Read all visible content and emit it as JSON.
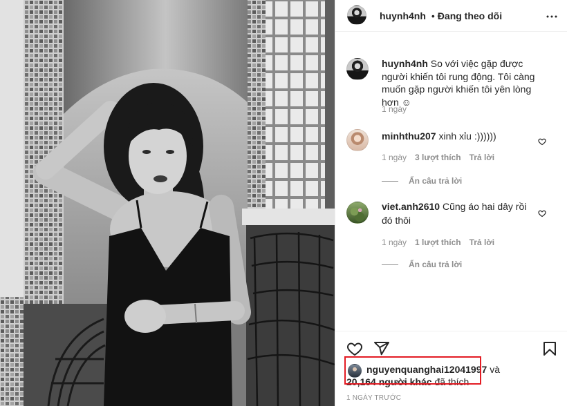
{
  "post": {
    "author": "huynh4nh",
    "separator": "•",
    "follow_status": "Đang theo dõi"
  },
  "caption": {
    "username": "huynh4nh",
    "text": "So với việc gặp được người khiến tôi rung động. Tôi càng muốn gặp người khiến tôi yên lòng hơn ☺",
    "time": "1 ngày"
  },
  "comments": [
    {
      "username": "minhthu207",
      "text": "xinh xỉu :))))))",
      "time": "1 ngày",
      "likes": "3 lượt thích",
      "reply": "Trả lời",
      "hide_replies": "Ẩn câu trả lời"
    },
    {
      "username": "viet.anh2610",
      "text": "Cũng áo hai dây rồi đó thôi",
      "time": "1 ngày",
      "likes": "1 lượt thích",
      "reply": "Trả lời",
      "hide_replies": "Ẩn câu trả lời"
    }
  ],
  "likes": {
    "user": "nguyenquanghai12041997",
    "connector": "và",
    "others": "20,164 người khác",
    "verb": "đã thích"
  },
  "timestamp": "1 NGÀY TRƯỚC",
  "icons": {
    "more": "more-options-icon",
    "like": "heart-icon",
    "share": "share-icon",
    "save": "bookmark-icon",
    "comment_like": "comment-like-icon"
  },
  "theme": {
    "text": "#262626",
    "muted": "#8e8e8e",
    "border": "#efefef",
    "highlight": "#e31b23"
  }
}
